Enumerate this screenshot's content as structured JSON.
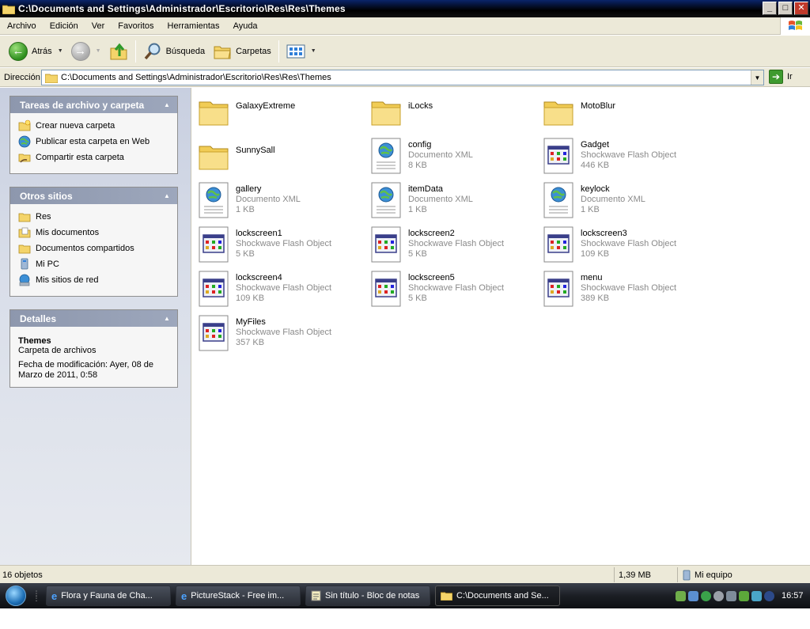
{
  "window": {
    "title": "C:\\Documents and Settings\\Administrador\\Escritorio\\Res\\Res\\Themes",
    "controls": [
      "_",
      "□",
      "✕"
    ]
  },
  "menu": [
    "Archivo",
    "Edición",
    "Ver",
    "Favoritos",
    "Herramientas",
    "Ayuda"
  ],
  "toolbar": {
    "back_label": "Atrás",
    "search_label": "Búsqueda",
    "folders_label": "Carpetas"
  },
  "address": {
    "label": "Dirección",
    "path": "C:\\Documents and Settings\\Administrador\\Escritorio\\Res\\Res\\Themes",
    "go_label": "Ir"
  },
  "panels": {
    "tasks": {
      "title": "Tareas de archivo y carpeta",
      "items": [
        {
          "label": "Crear nueva carpeta",
          "icon": "new-folder-icon"
        },
        {
          "label": "Publicar esta carpeta en Web",
          "icon": "publish-web-icon"
        },
        {
          "label": "Compartir esta carpeta",
          "icon": "share-folder-icon"
        }
      ]
    },
    "places": {
      "title": "Otros sitios",
      "items": [
        {
          "label": "Res",
          "icon": "folder-icon"
        },
        {
          "label": "Mis documentos",
          "icon": "documents-icon"
        },
        {
          "label": "Documentos compartidos",
          "icon": "shared-documents-icon"
        },
        {
          "label": "Mi PC",
          "icon": "computer-icon"
        },
        {
          "label": "Mis sitios de red",
          "icon": "network-icon"
        }
      ]
    },
    "details": {
      "title": "Detalles",
      "name": "Themes",
      "type": "Carpeta de archivos",
      "modified_1": "Fecha de modificación: Ayer, 08 de",
      "modified_2": "Marzo de 2011, 0:58"
    }
  },
  "files": [
    {
      "name": "GalaxyExtreme",
      "kind": "folder"
    },
    {
      "name": "iLocks",
      "kind": "folder"
    },
    {
      "name": "MotoBlur",
      "kind": "folder"
    },
    {
      "name": "SunnySall",
      "kind": "folder"
    },
    {
      "name": "config",
      "type": "Documento XML",
      "size": "8 KB",
      "kind": "xml"
    },
    {
      "name": "Gadget",
      "type": "Shockwave Flash Object",
      "size": "446 KB",
      "kind": "swf"
    },
    {
      "name": "gallery",
      "type": "Documento XML",
      "size": "1 KB",
      "kind": "xml"
    },
    {
      "name": "itemData",
      "type": "Documento XML",
      "size": "1 KB",
      "kind": "xml"
    },
    {
      "name": "keylock",
      "type": "Documento XML",
      "size": "1 KB",
      "kind": "xml"
    },
    {
      "name": "lockscreen1",
      "type": "Shockwave Flash Object",
      "size": "5 KB",
      "kind": "swf"
    },
    {
      "name": "lockscreen2",
      "type": "Shockwave Flash Object",
      "size": "5 KB",
      "kind": "swf"
    },
    {
      "name": "lockscreen3",
      "type": "Shockwave Flash Object",
      "size": "109 KB",
      "kind": "swf"
    },
    {
      "name": "lockscreen4",
      "type": "Shockwave Flash Object",
      "size": "109 KB",
      "kind": "swf"
    },
    {
      "name": "lockscreen5",
      "type": "Shockwave Flash Object",
      "size": "5 KB",
      "kind": "swf"
    },
    {
      "name": "menu",
      "type": "Shockwave Flash Object",
      "size": "389 KB",
      "kind": "swf"
    },
    {
      "name": "MyFiles",
      "type": "Shockwave Flash Object",
      "size": "357 KB",
      "kind": "swf"
    }
  ],
  "status": {
    "count": "16 objetos",
    "size": "1,39 MB",
    "location": "Mi equipo"
  },
  "taskbar": {
    "tasks": [
      {
        "label": "Flora y Fauna de Cha...",
        "icon": "ie-icon"
      },
      {
        "label": "PictureStack - Free im...",
        "icon": "ie-icon"
      },
      {
        "label": "Sin título - Bloc de notas",
        "icon": "notepad-icon"
      },
      {
        "label": "C:\\Documents and Se...",
        "icon": "folder-icon"
      }
    ],
    "clock": "16:57"
  }
}
